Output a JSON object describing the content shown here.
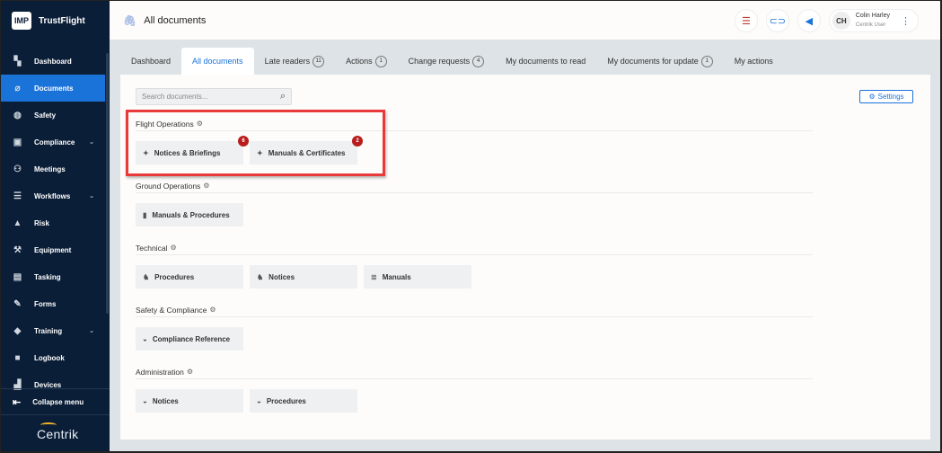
{
  "brand": {
    "logo_text": "IMP",
    "name": "TrustFlight",
    "footer_logo": "Centrik"
  },
  "sidebar": {
    "items": [
      {
        "label": "Dashboard",
        "icon": "dashboard-icon",
        "glyph": "▚"
      },
      {
        "label": "Documents",
        "icon": "paperclip-icon",
        "glyph": "⌀",
        "active": true
      },
      {
        "label": "Safety",
        "icon": "shield-icon",
        "glyph": "◍"
      },
      {
        "label": "Compliance",
        "icon": "compliance-icon",
        "glyph": "▣",
        "chevron": true
      },
      {
        "label": "Meetings",
        "icon": "meetings-icon",
        "glyph": "⚇"
      },
      {
        "label": "Workflows",
        "icon": "workflows-icon",
        "glyph": "☰",
        "chevron": true
      },
      {
        "label": "Risk",
        "icon": "warning-icon",
        "glyph": "▲"
      },
      {
        "label": "Equipment",
        "icon": "wrench-icon",
        "glyph": "⚒"
      },
      {
        "label": "Tasking",
        "icon": "tasking-icon",
        "glyph": "▤"
      },
      {
        "label": "Forms",
        "icon": "forms-icon",
        "glyph": "✎"
      },
      {
        "label": "Training",
        "icon": "graduation-icon",
        "glyph": "◆",
        "chevron": true
      },
      {
        "label": "Logbook",
        "icon": "logbook-icon",
        "glyph": "■"
      },
      {
        "label": "Devices",
        "icon": "devices-icon",
        "glyph": "▟"
      }
    ],
    "collapse_label": "Collapse menu"
  },
  "header": {
    "title": "All documents",
    "user": {
      "initials": "CH",
      "name": "Colin Harley",
      "role": "Centrik User"
    }
  },
  "tabs": [
    {
      "label": "Dashboard"
    },
    {
      "label": "All documents",
      "active": true
    },
    {
      "label": "Late readers",
      "count": "11"
    },
    {
      "label": "Actions",
      "count": "1"
    },
    {
      "label": "Change requests",
      "count": "4"
    },
    {
      "label": "My documents to read"
    },
    {
      "label": "My documents for update",
      "count": "1"
    },
    {
      "label": "My actions"
    }
  ],
  "search": {
    "placeholder": "Search documents..."
  },
  "settings_label": "Settings",
  "sections": [
    {
      "title": "Flight Operations",
      "cards": [
        {
          "label": "Notices & Briefings",
          "icon": "sparkle-icon",
          "glyph": "✦",
          "badge": "6"
        },
        {
          "label": "Manuals & Certificates",
          "icon": "sparkle-icon",
          "glyph": "✦",
          "badge": "2"
        }
      ]
    },
    {
      "title": "Ground Operations",
      "cards": [
        {
          "label": "Manuals & Procedures",
          "icon": "book-icon",
          "glyph": "▮"
        }
      ]
    },
    {
      "title": "Technical",
      "cards": [
        {
          "label": "Procedures",
          "icon": "tech-icon",
          "glyph": "♞"
        },
        {
          "label": "Notices",
          "icon": "tech-icon",
          "glyph": "♞"
        },
        {
          "label": "Manuals",
          "icon": "stack-icon",
          "glyph": "≣"
        }
      ]
    },
    {
      "title": "Safety & Compliance",
      "cards": [
        {
          "label": "Compliance Reference",
          "icon": "disk-icon",
          "glyph": "◒"
        }
      ]
    },
    {
      "title": "Administration",
      "cards": [
        {
          "label": "Notices",
          "icon": "disk-icon",
          "glyph": "◒"
        },
        {
          "label": "Procedures",
          "icon": "disk-icon",
          "glyph": "◒"
        }
      ]
    }
  ]
}
